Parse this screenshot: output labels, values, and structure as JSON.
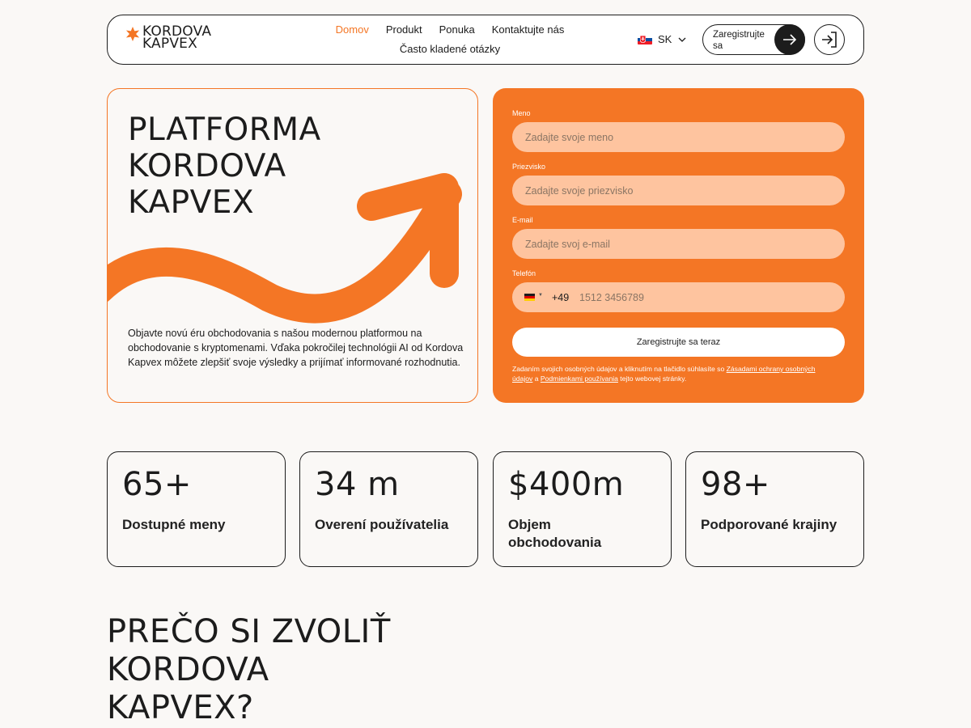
{
  "header": {
    "logo": {
      "line1": "KORDOVA",
      "line2": "KAPVEX"
    },
    "nav_row1": [
      "Domov",
      "Produkt",
      "Ponuka",
      "Kontaktujte nás"
    ],
    "nav_row2": [
      "Často kladené otázky"
    ],
    "language": "SK",
    "register_label": "Zaregistrujte sa"
  },
  "hero": {
    "title_lines": [
      "PLATFORMA",
      "KORDOVA",
      "KAPVEX"
    ],
    "description": "Objavte novú éru obchodovania s našou modernou platformou na obchodovanie s kryptomenami. Vďaka pokročilej technológii AI od Kordova Kapvex môžete zlepšiť svoje výsledky a prijímať informované rozhodnutia."
  },
  "form": {
    "first_name": {
      "label": "Meno",
      "placeholder": "Zadajte svoje meno"
    },
    "last_name": {
      "label": "Priezvisko",
      "placeholder": "Zadajte svoje priezvisko"
    },
    "email": {
      "label": "E-mail",
      "placeholder": "Zadajte svoj e-mail"
    },
    "phone": {
      "label": "Telefón",
      "code": "+49",
      "placeholder": "1512 3456789"
    },
    "submit_label": "Zaregistrujte sa teraz",
    "consent": {
      "before": "Zadaním svojich osobných údajov a kliknutím na tlačidlo súhlasíte so ",
      "link1": "Zásadami ochrany osobných údajov",
      "middle": " a ",
      "link2": "Podmienkami používania",
      "after": " tejto webovej stránky."
    }
  },
  "stats": [
    {
      "value": "65+",
      "label": "Dostupné meny"
    },
    {
      "value": "34 m",
      "label": "Overení používatelia"
    },
    {
      "value": "$400m",
      "label": "Objem obchodovania"
    },
    {
      "value": "98+",
      "label": "Podporované krajiny"
    }
  ],
  "why": {
    "title_lines": [
      "PREČO SI ZVOLIŤ",
      "KORDOVA",
      "KAPVEX?"
    ]
  },
  "colors": {
    "accent": "#f47625",
    "input_bg": "#fec49f",
    "dark": "#1c1c1c",
    "page_bg": "#faf8f6"
  }
}
